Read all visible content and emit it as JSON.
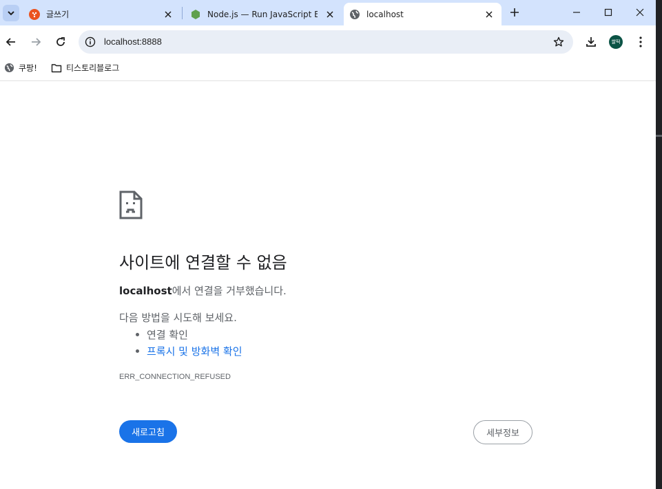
{
  "tabs": [
    {
      "title": "글쓰기",
      "favicon": "tistory-icon",
      "active": false
    },
    {
      "title": "Node.js — Run JavaScript Eve",
      "favicon": "nodejs-icon",
      "active": false
    },
    {
      "title": "localhost",
      "favicon": "globe-icon",
      "active": true
    }
  ],
  "toolbar": {
    "url": "localhost:8888",
    "profile_initials": "쌀떡"
  },
  "bookmarks": [
    {
      "label": "쿠팡!",
      "icon": "globe-icon"
    },
    {
      "label": "티스토리블로그",
      "icon": "folder-icon"
    }
  ],
  "error": {
    "title": "사이트에 연결할 수 없음",
    "host": "localhost",
    "message_suffix": "에서 연결을 거부했습니다.",
    "try_label": "다음 방법을 시도해 보세요.",
    "suggestions": [
      "연결 확인",
      "프록시 및 방화벽 확인"
    ],
    "code": "ERR_CONNECTION_REFUSED",
    "reload_label": "새로고침",
    "details_label": "세부정보"
  },
  "colors": {
    "tabstrip": "#d3e3fd",
    "accent": "#1a73e8",
    "omnibox": "#e9eef6"
  }
}
